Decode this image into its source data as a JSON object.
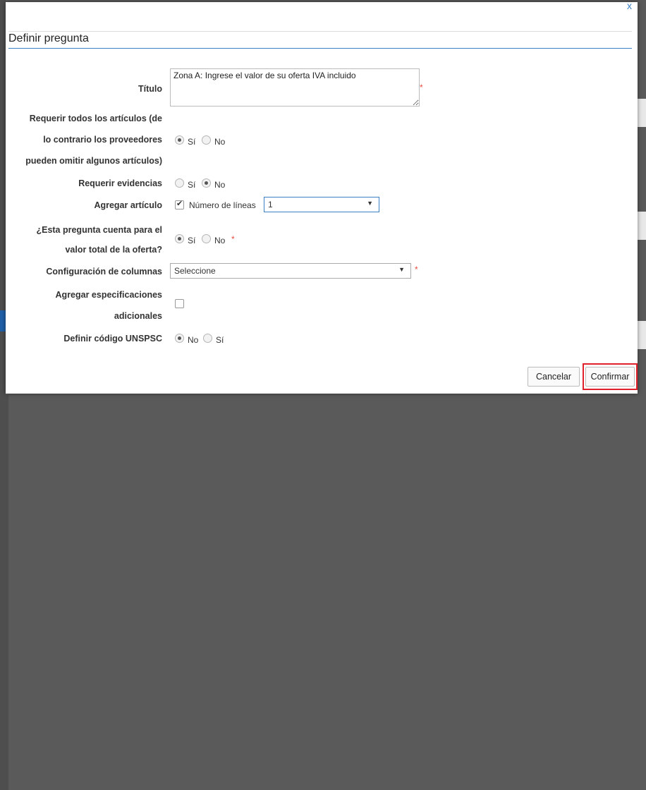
{
  "dialog": {
    "title": "Definir pregunta",
    "close_label": "x"
  },
  "form": {
    "titulo": {
      "label": "Título",
      "value": "Zona A: Ingrese el valor de su oferta IVA incluido",
      "required_mark": "*"
    },
    "requerir_articulos": {
      "label_lines": [
        "Requerir todos los artículos (de",
        "lo contrario los proveedores",
        "pueden omitir algunos artículos)"
      ],
      "options": [
        "Sí",
        "No"
      ],
      "selected": "Sí"
    },
    "requerir_evidencias": {
      "label": "Requerir evidencias",
      "options": [
        "Sí",
        "No"
      ],
      "selected": "No"
    },
    "agregar_articulo": {
      "label": "Agregar artículo",
      "checked": true,
      "lineas_label": "Número de líneas",
      "lineas_value": "1"
    },
    "cuenta_valor_total": {
      "label_lines": [
        "¿Esta pregunta cuenta para el",
        "valor total de la oferta?"
      ],
      "options": [
        "Sí",
        "No"
      ],
      "selected": "Sí",
      "required_mark": "*"
    },
    "configuracion_columnas": {
      "label": "Configuración de columnas",
      "value": "Seleccione",
      "required_mark": "*"
    },
    "especificaciones": {
      "label_lines": [
        "Agregar especificaciones",
        "adicionales"
      ],
      "checked": false
    },
    "unspsc": {
      "label": "Definir código UNSPSC",
      "options": [
        "No",
        "Sí"
      ],
      "selected": "No"
    }
  },
  "footer": {
    "cancel_label": "Cancelar",
    "confirm_label": "Confirmar"
  },
  "colors": {
    "accent": "#3b7fc4",
    "required": "#e74c3c",
    "highlight_box": "#e0202a"
  }
}
